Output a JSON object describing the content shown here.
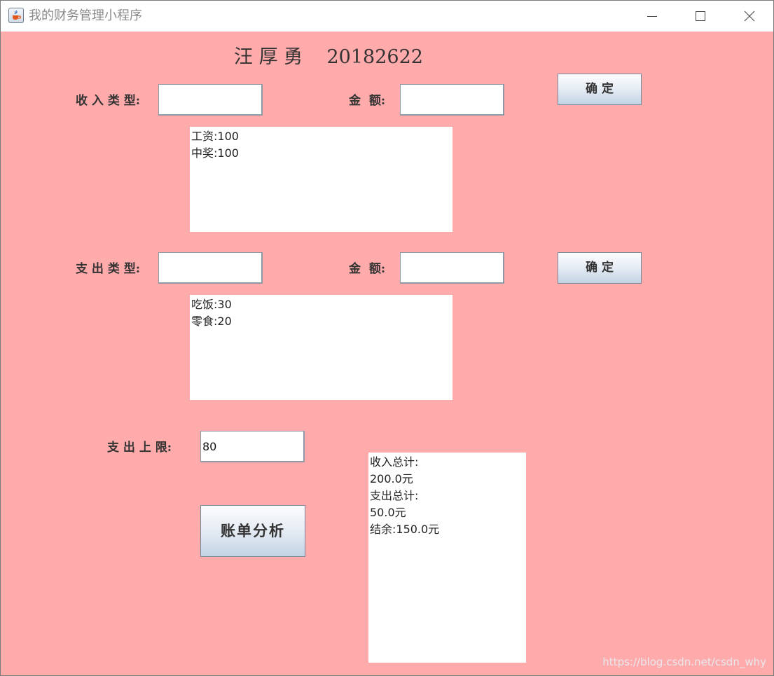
{
  "window": {
    "title": "我的财务管理小程序",
    "icon": "java-cup-icon",
    "controls": [
      "minimize-icon",
      "maximize-icon",
      "close-icon"
    ]
  },
  "header": {
    "title": "汪 厚 勇    20182622"
  },
  "income": {
    "type_label": "收 入 类 型:",
    "amount_label": "金  额:",
    "type_value": "",
    "amount_value": "",
    "confirm_label": "确 定",
    "list": [
      "工资:100",
      "中奖:100"
    ]
  },
  "expense": {
    "type_label": "支 出 类 型:",
    "amount_label": "金  额:",
    "type_value": "",
    "amount_value": "",
    "confirm_label": "确 定",
    "list": [
      "吃饭:30",
      "零食:20"
    ]
  },
  "limit": {
    "label": "支 出 上 限:",
    "value": "80"
  },
  "analyze_button": "账单分析",
  "summary": {
    "lines": [
      "收入总计:",
      "200.0元",
      "支出总计:",
      "50.0元",
      "结余:150.0元"
    ]
  },
  "watermark": "https://blog.csdn.net/csdn_why",
  "colors": {
    "background": "#ffaaab",
    "button_top": "#fbfcfe",
    "button_bottom": "#c3d3e4",
    "text": "#333333"
  }
}
